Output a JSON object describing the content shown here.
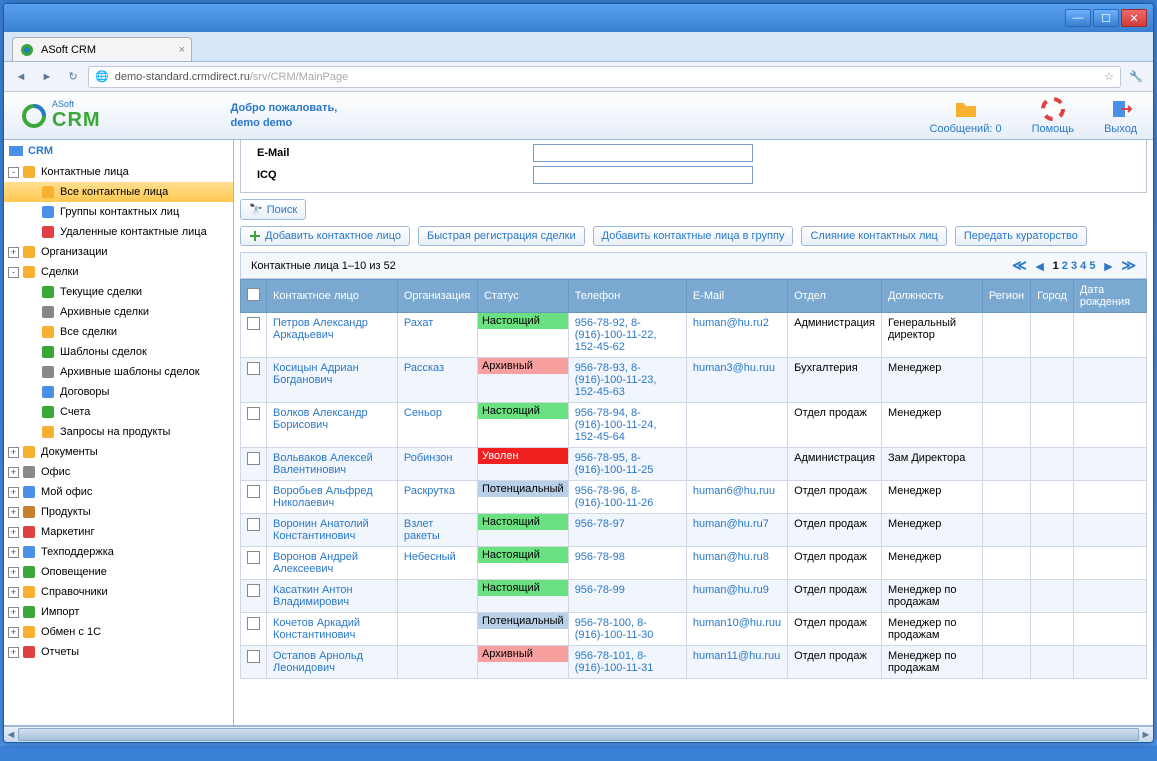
{
  "browser": {
    "tab_title": "ASoft CRM",
    "url_host": "demo-standard.crmdirect.ru",
    "url_path": "/srv/CRM/MainPage"
  },
  "header": {
    "logo_small": "ASoft",
    "logo_big": "CRM",
    "welcome_line1": "Добро пожаловать,",
    "welcome_line2": "demo demo",
    "messages_label": "Сообщений: 0",
    "help_label": "Помощь",
    "exit_label": "Выход"
  },
  "sidebar": {
    "root": "CRM",
    "items": [
      {
        "label": "Контактные лица",
        "icon": "people",
        "toggle": "-",
        "depth": 0,
        "children": [
          {
            "label": "Все контактные лица",
            "icon": "people",
            "selected": true
          },
          {
            "label": "Группы контактных лиц",
            "icon": "groups"
          },
          {
            "label": "Удаленные контактные лица",
            "icon": "trash-people"
          }
        ]
      },
      {
        "label": "Организации",
        "icon": "org",
        "toggle": "+",
        "depth": 0
      },
      {
        "label": "Сделки",
        "icon": "deal",
        "toggle": "-",
        "depth": 0,
        "children": [
          {
            "label": "Текущие сделки",
            "icon": "doc"
          },
          {
            "label": "Архивные сделки",
            "icon": "archive"
          },
          {
            "label": "Все сделки",
            "icon": "deal"
          },
          {
            "label": "Шаблоны сделок",
            "icon": "template"
          },
          {
            "label": "Архивные шаблоны сделок",
            "icon": "archive"
          },
          {
            "label": "Договоры",
            "icon": "contract"
          },
          {
            "label": "Счета",
            "icon": "invoice"
          },
          {
            "label": "Запросы на продукты",
            "icon": "request"
          }
        ]
      },
      {
        "label": "Документы",
        "icon": "docs",
        "toggle": "+",
        "depth": 0
      },
      {
        "label": "Офис",
        "icon": "office",
        "toggle": "+",
        "depth": 0
      },
      {
        "label": "Мой офис",
        "icon": "myoffice",
        "toggle": "+",
        "depth": 0
      },
      {
        "label": "Продукты",
        "icon": "products",
        "toggle": "+",
        "depth": 0
      },
      {
        "label": "Маркетинг",
        "icon": "marketing",
        "toggle": "+",
        "depth": 0
      },
      {
        "label": "Техподдержка",
        "icon": "support",
        "toggle": "+",
        "depth": 0
      },
      {
        "label": "Оповещение",
        "icon": "notify",
        "toggle": "+",
        "depth": 0
      },
      {
        "label": "Справочники",
        "icon": "refs",
        "toggle": "+",
        "depth": 0
      },
      {
        "label": "Импорт",
        "icon": "import",
        "toggle": "+",
        "depth": 0
      },
      {
        "label": "Обмен с 1С",
        "icon": "exchange",
        "toggle": "+",
        "depth": 0
      },
      {
        "label": "Отчеты",
        "icon": "reports",
        "toggle": "+",
        "depth": 0
      }
    ]
  },
  "filters": {
    "email_label": "E-Mail",
    "icq_label": "ICQ"
  },
  "buttons": {
    "search": "Поиск",
    "add": "Добавить контактное лицо",
    "quick": "Быстрая регистрация сделки",
    "addgroup": "Добавить контактные лица в группу",
    "merge": "Слияние контактных лиц",
    "transfer": "Передать кураторство"
  },
  "list": {
    "summary": "Контактные лица 1–10 из 52",
    "pages": [
      "1",
      "2",
      "3",
      "4",
      "5"
    ],
    "current_page": "1",
    "columns": [
      "Контактное лицо",
      "Организация",
      "Статус",
      "Телефон",
      "E-Mail",
      "Отдел",
      "Должность",
      "Регион",
      "Город",
      "Дата рождения"
    ],
    "rows": [
      {
        "name": "Петров Александр Аркадьевич",
        "org": "Рахат",
        "status": "Настоящий",
        "status_cls": "st-green",
        "phone": "956-78-92, 8-(916)-100-11-22, 152-45-62",
        "email": "human@hu.ru2",
        "dept": "Администрация",
        "pos": "Генеральный директор"
      },
      {
        "name": "Косицын Адриан Богданович",
        "org": "Рассказ",
        "status": "Архивный",
        "status_cls": "st-pink",
        "phone": "956-78-93, 8-(916)-100-11-23, 152-45-63",
        "email": "human3@hu.ruu",
        "dept": "Бухгалтерия",
        "pos": "Менеджер"
      },
      {
        "name": "Волков Александр Борисович",
        "org": "Сеньор",
        "status": "Настоящий",
        "status_cls": "st-green",
        "phone": "956-78-94, 8-(916)-100-11-24, 152-45-64",
        "email": "",
        "dept": "Отдел продаж",
        "pos": "Менеджер"
      },
      {
        "name": "Вольваков Алексей Валентинович",
        "org": "Робинзон",
        "status": "Уволен",
        "status_cls": "st-red",
        "phone": "956-78-95, 8-(916)-100-11-25",
        "email": "",
        "dept": "Администрация",
        "pos": "Зам Директора"
      },
      {
        "name": "Воробьев Альфред Николаевич",
        "org": "Раскрутка",
        "status": "Потенциальный",
        "status_cls": "st-blue",
        "phone": "956-78-96, 8-(916)-100-11-26",
        "email": "human6@hu.ruu",
        "dept": "Отдел продаж",
        "pos": "Менеджер"
      },
      {
        "name": "Воронин Анатолий Константинович",
        "org": "Взлет ракеты",
        "status": "Настоящий",
        "status_cls": "st-green",
        "phone": "956-78-97",
        "email": "human@hu.ru7",
        "dept": "Отдел продаж",
        "pos": "Менеджер"
      },
      {
        "name": "Воронов Андрей Алексеевич",
        "org": "Небесный",
        "status": "Настоящий",
        "status_cls": "st-green",
        "phone": "956-78-98",
        "email": "human@hu.ru8",
        "dept": "Отдел продаж",
        "pos": "Менеджер"
      },
      {
        "name": "Касаткин Антон Владимирович",
        "org": "",
        "status": "Настоящий",
        "status_cls": "st-green",
        "phone": "956-78-99",
        "email": "human@hu.ru9",
        "dept": "Отдел продаж",
        "pos": "Менеджер по продажам"
      },
      {
        "name": "Кочетов Аркадий Константинович",
        "org": "",
        "status": "Потенциальный",
        "status_cls": "st-blue",
        "phone": "956-78-100, 8-(916)-100-11-30",
        "email": "human10@hu.ruu",
        "dept": "Отдел продаж",
        "pos": "Менеджер по продажам"
      },
      {
        "name": "Остапов Арнольд Леонидович",
        "org": "",
        "status": "Архивный",
        "status_cls": "st-pink",
        "phone": "956-78-101, 8-(916)-100-11-31",
        "email": "human11@hu.ruu",
        "dept": "Отдел продаж",
        "pos": "Менеджер по продажам"
      }
    ]
  }
}
